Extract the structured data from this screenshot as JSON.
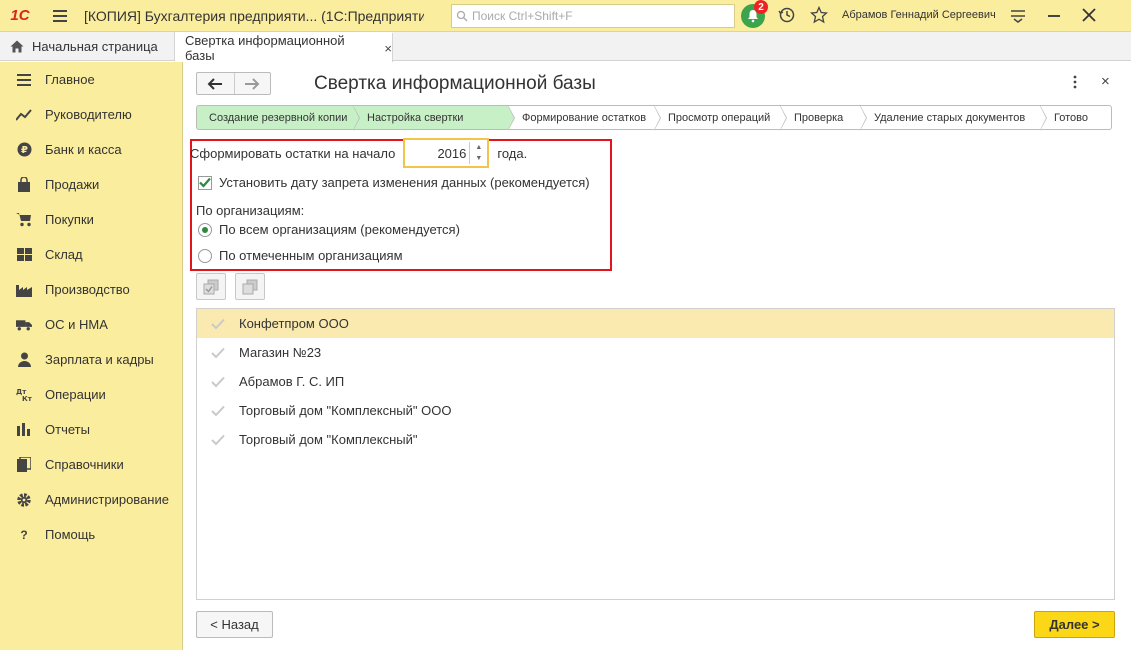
{
  "app": {
    "logo": "1С",
    "title": "[КОПИЯ] Бухгалтерия предприяти... (1С:Предприятие)",
    "notifications_count": "2",
    "user_name": "Абрамов Геннадий Сергеевич"
  },
  "search": {
    "placeholder": "Поиск Ctrl+Shift+F"
  },
  "tabs": {
    "home_label": "Начальная страница",
    "active_label": "Свертка информационной базы",
    "close_glyph": "×"
  },
  "sidebar": {
    "items": [
      {
        "label": "Главное",
        "icon": "menu-icon"
      },
      {
        "label": "Руководителю",
        "icon": "trend-icon"
      },
      {
        "label": "Банк и касса",
        "icon": "ruble-icon"
      },
      {
        "label": "Продажи",
        "icon": "bag-icon"
      },
      {
        "label": "Покупки",
        "icon": "cart-icon"
      },
      {
        "label": "Склад",
        "icon": "warehouse-icon"
      },
      {
        "label": "Производство",
        "icon": "factory-icon"
      },
      {
        "label": "ОС и НМА",
        "icon": "truck-icon"
      },
      {
        "label": "Зарплата и кадры",
        "icon": "person-icon"
      },
      {
        "label": "Операции",
        "icon": "dt-kt-icon"
      },
      {
        "label": "Отчеты",
        "icon": "bars-icon"
      },
      {
        "label": "Справочники",
        "icon": "books-icon"
      },
      {
        "label": "Администрирование",
        "icon": "gear-icon"
      },
      {
        "label": "Помощь",
        "icon": "question-icon"
      }
    ]
  },
  "form": {
    "title": "Свертка информационной базы",
    "close_glyph": "×",
    "steps": [
      {
        "label": "Создание резервной копии",
        "done": true
      },
      {
        "label": "Настройка свертки",
        "done": true
      },
      {
        "label": "Формирование остатков",
        "done": false
      },
      {
        "label": "Просмотр операций",
        "done": false
      },
      {
        "label": "Проверка",
        "done": false
      },
      {
        "label": "Удаление старых документов",
        "done": false
      },
      {
        "label": "Готово",
        "done": false
      }
    ],
    "balance_label": "Сформировать остатки на начало",
    "year_value": "2016",
    "year_suffix": "года.",
    "lock_date_label": "Установить дату запрета изменения данных (рекомендуется)",
    "lock_date_checked": true,
    "orgs_label": "По организациям:",
    "radio_all": "По всем организациям (рекомендуется)",
    "radio_selected": "По отмеченным организациям",
    "radio_value": "all"
  },
  "orgs": [
    {
      "name": "Конфетпром ООО",
      "selected": true
    },
    {
      "name": "Магазин №23",
      "selected": false
    },
    {
      "name": "Абрамов Г. С. ИП",
      "selected": false
    },
    {
      "name": "Торговый дом \"Комплексный\" ООО",
      "selected": false
    },
    {
      "name": "Торговый дом \"Комплексный\"",
      "selected": false
    }
  ],
  "buttons": {
    "back_label": "< Назад",
    "next_label": "Далее >"
  },
  "colors": {
    "topbar": "#fbed9e",
    "step_done": "#c8f0c6",
    "highlight_frame": "#e2141c",
    "next_button": "#fbd717",
    "selected_row": "#fbeab0"
  }
}
